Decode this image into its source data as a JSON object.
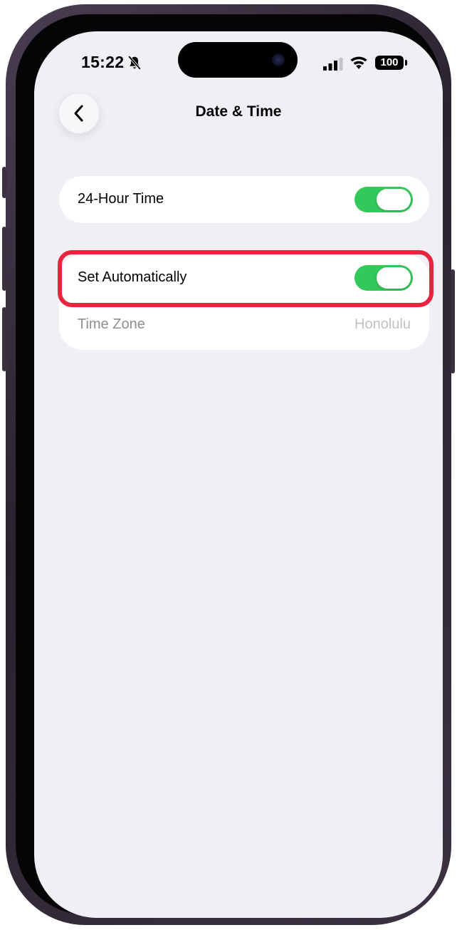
{
  "status_bar": {
    "time": "15:22",
    "battery": "100",
    "icons": [
      "bell-slash-icon",
      "signal-icon",
      "wifi-icon",
      "battery-icon"
    ]
  },
  "nav": {
    "back_icon": "chevron-left-icon",
    "title": "Date & Time"
  },
  "settings": {
    "hour_24": {
      "label": "24-Hour Time",
      "enabled": true
    },
    "set_automatically": {
      "label": "Set Automatically",
      "enabled": true
    },
    "time_zone": {
      "label": "Time Zone",
      "value": "Honolulu"
    }
  },
  "colors": {
    "toggle_on": "#34c759",
    "highlight": "#e8253f",
    "background": "#f0eff5"
  }
}
